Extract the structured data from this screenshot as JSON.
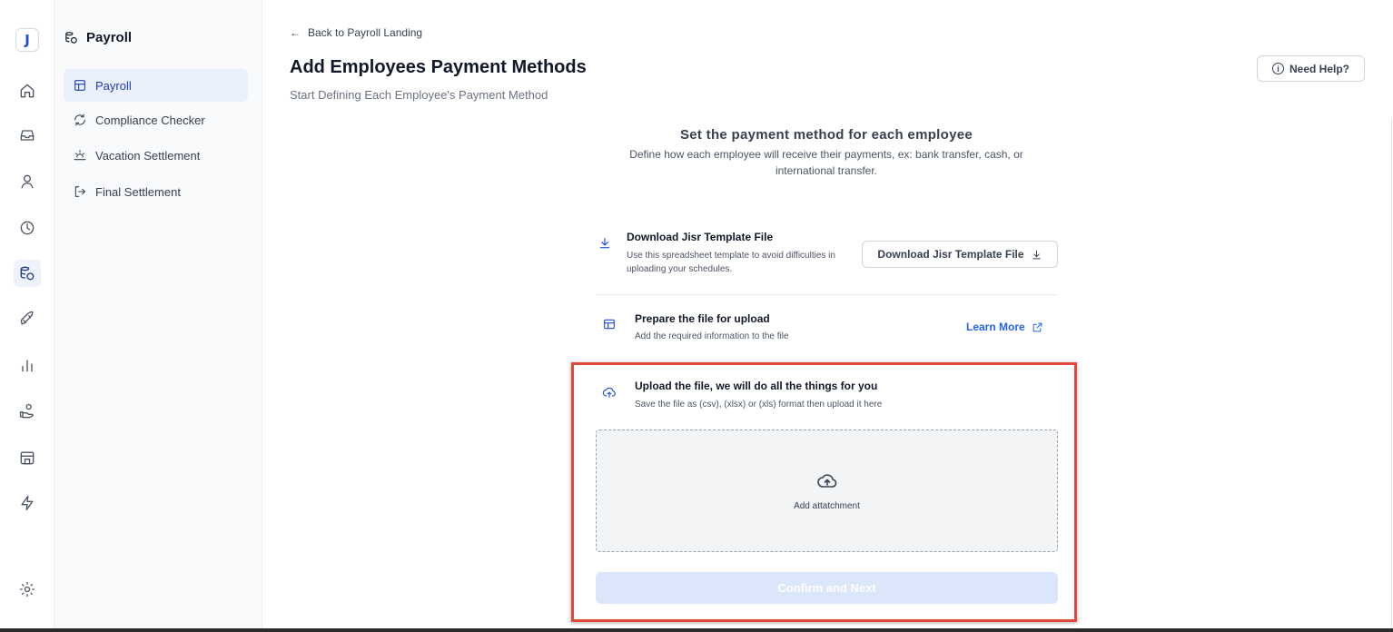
{
  "app": {
    "logo_letter": "J"
  },
  "rail": {
    "items": [
      "home-icon",
      "inbox-icon",
      "user-icon",
      "clock-icon",
      "payroll-icon",
      "rocket-icon",
      "chart-icon",
      "hand-coins-icon",
      "calendar-icon",
      "lightning-icon"
    ],
    "active": "payroll-icon",
    "settings": "gear-icon"
  },
  "sidebar": {
    "title": "Payroll",
    "items": [
      {
        "label": "Payroll",
        "icon": "table-icon",
        "active": true
      },
      {
        "label": "Compliance Checker",
        "icon": "refresh-icon",
        "active": false
      },
      {
        "label": "Vacation Settlement",
        "icon": "sunset-icon",
        "active": false
      },
      {
        "label": "Final Settlement",
        "icon": "logout-icon",
        "active": false
      }
    ]
  },
  "header": {
    "back_link": "Back to Payroll Landing",
    "title": "Add Employees Payment Methods",
    "subtitle": "Start Defining Each Employee's Payment Method",
    "help_button": "Need Help?"
  },
  "section": {
    "title": "Set the payment method for each employee",
    "description": "Define how each employee will receive their payments, ex: bank transfer, cash, or international transfer."
  },
  "steps": {
    "download": {
      "title": "Download Jisr Template File",
      "description": "Use this spreadsheet template to avoid difficulties in uploading your schedules.",
      "button": "Download Jisr Template File"
    },
    "prepare": {
      "title": "Prepare the file for upload",
      "description": "Add the required information to the file",
      "link": "Learn More"
    },
    "upload": {
      "title": "Upload the file, we will do all the things for you",
      "description": "Save the file as (csv), (xlsx) or (xls) format then upload it here",
      "dropzone_label": "Add attatchment"
    }
  },
  "confirm_button": "Confirm and Next",
  "colors": {
    "accent": "#2563eb",
    "highlight_border": "#e0483b",
    "confirm_disabled": "#dbe6fb"
  }
}
